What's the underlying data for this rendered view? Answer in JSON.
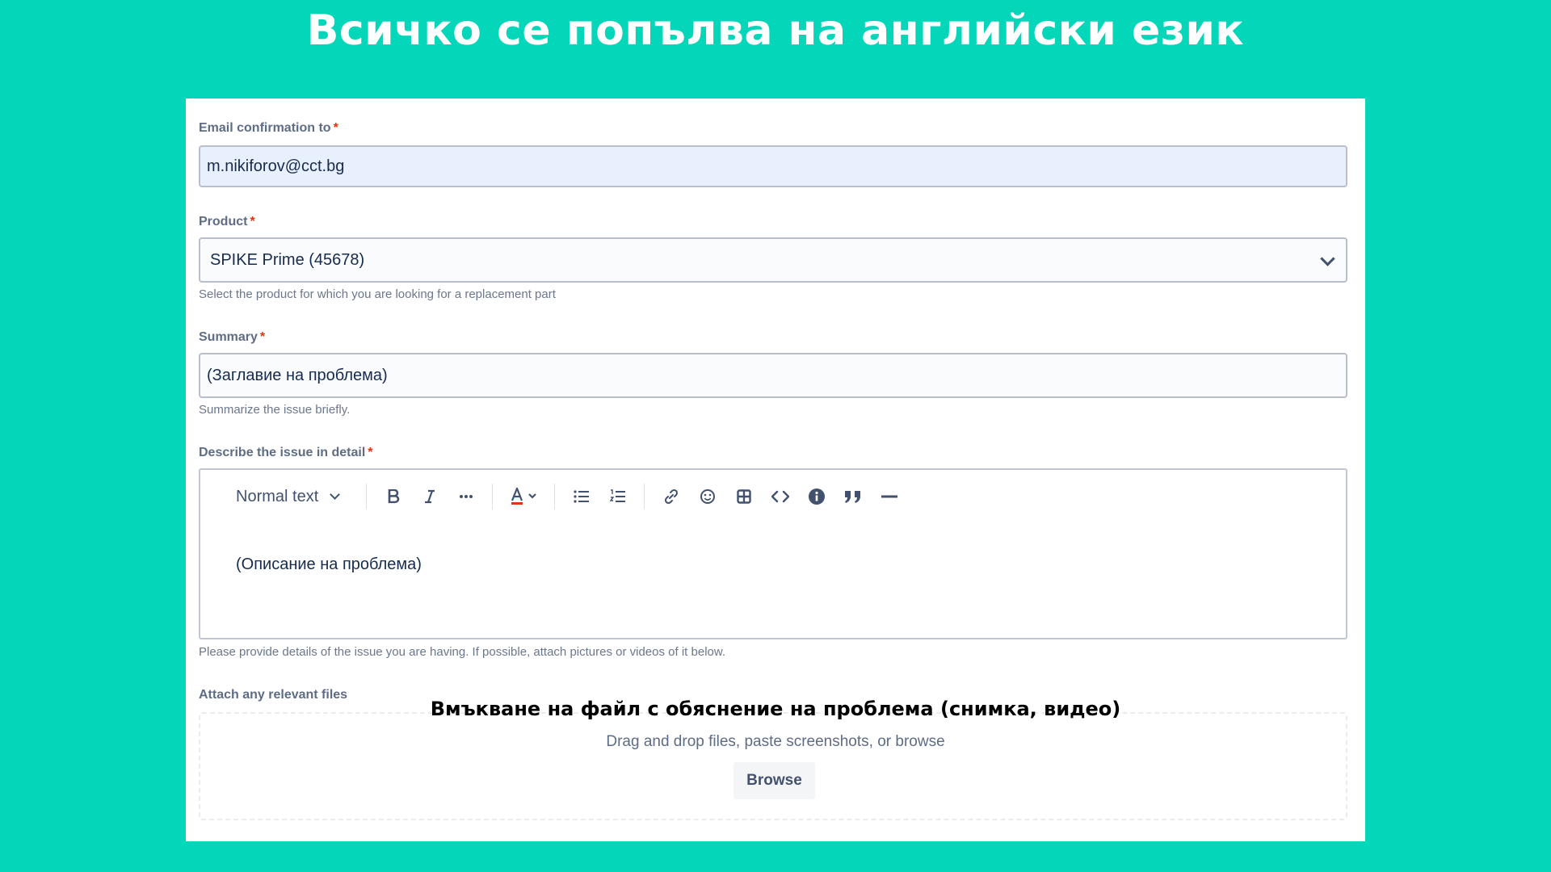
{
  "banner": {
    "title": "Всичко се попълва на английски език"
  },
  "form": {
    "email": {
      "label": "Email confirmation to",
      "required_mark": "*",
      "value": "m.nikiforov@cct.bg"
    },
    "product": {
      "label": "Product",
      "required_mark": "*",
      "selected": "SPIKE Prime (45678)",
      "help": "Select the product for which you are looking for a replacement part"
    },
    "summary": {
      "label": "Summary",
      "required_mark": "*",
      "value": "(Заглавие на проблема)",
      "help": "Summarize the issue briefly."
    },
    "description": {
      "label": "Describe the issue in detail",
      "required_mark": "*",
      "toolbar": {
        "text_style": "Normal text",
        "more_label": "···"
      },
      "content": "(Описание на проблема)",
      "help": "Please provide details of the issue you are having. If possible, attach pictures or videos of it below."
    },
    "attachments": {
      "label": "Attach any relevant files",
      "overlay_note": "Вмъкване на файл с обяснение на проблема (снимка, видео)",
      "drop_text": "Drag and drop files, paste screenshots, or browse",
      "browse_label": "Browse"
    }
  },
  "icons": [
    "bold-icon",
    "italic-icon",
    "more-icon",
    "text-color-icon",
    "bullet-list-icon",
    "numbered-list-icon",
    "link-icon",
    "emoji-icon",
    "table-icon",
    "code-icon",
    "info-icon",
    "quote-icon",
    "divider-icon"
  ],
  "colors": {
    "background": "#03d6b9",
    "required": "#de350b",
    "email_autofill": "#e8f0fe"
  }
}
